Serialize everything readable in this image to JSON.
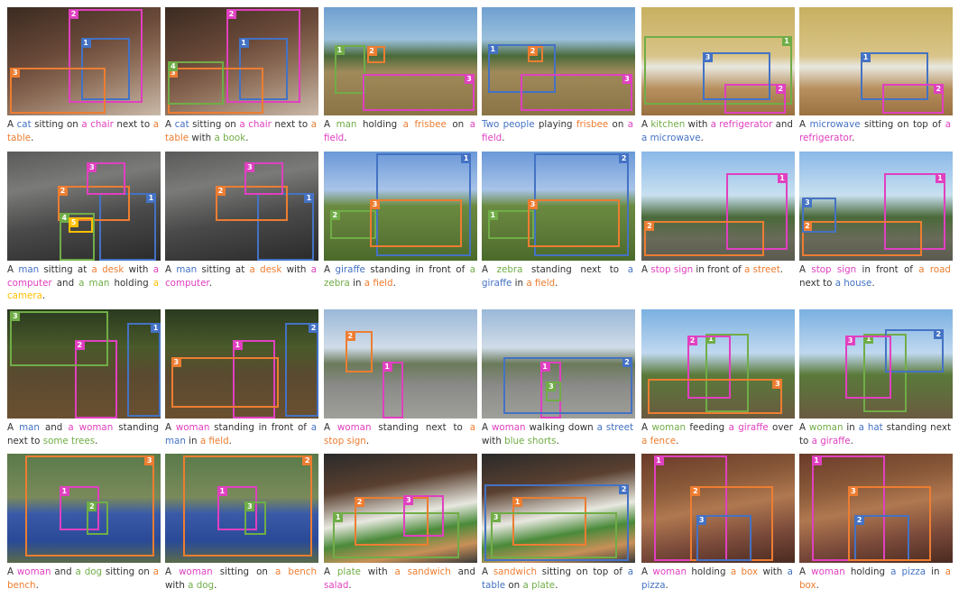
{
  "colors": {
    "blue": "#4472c4",
    "pink": "#e040c0",
    "orange": "#ed7d31",
    "green": "#70ad47",
    "yellow": "#ffc000",
    "text": "#333333"
  },
  "panels": [
    {
      "caption": [
        [
          "A ",
          "text"
        ],
        [
          "cat",
          "blue"
        ],
        [
          " sitting on ",
          "text"
        ],
        [
          "a chair",
          "pink"
        ],
        [
          " next to ",
          "text"
        ],
        [
          "a table",
          "orange"
        ],
        [
          ".",
          "text"
        ]
      ],
      "tags": [
        [
          "1",
          "blue"
        ],
        [
          "2",
          "pink"
        ],
        [
          "3",
          "orange"
        ]
      ],
      "scene": "cat-room"
    },
    {
      "caption": [
        [
          "A ",
          "text"
        ],
        [
          "cat",
          "blue"
        ],
        [
          " sitting on ",
          "text"
        ],
        [
          "a chair",
          "pink"
        ],
        [
          " next to ",
          "text"
        ],
        [
          "a table",
          "orange"
        ],
        [
          " with ",
          "text"
        ],
        [
          "a book",
          "green"
        ],
        [
          ".",
          "text"
        ]
      ],
      "tags": [
        [
          "1",
          "blue"
        ],
        [
          "2",
          "pink"
        ],
        [
          "3",
          "orange"
        ],
        [
          "4",
          "green"
        ]
      ],
      "scene": "cat-room"
    },
    {
      "caption": [
        [
          "A ",
          "text"
        ],
        [
          "man",
          "green"
        ],
        [
          " holding ",
          "text"
        ],
        [
          "a frisbee",
          "orange"
        ],
        [
          " on ",
          "text"
        ],
        [
          "a field",
          "pink"
        ],
        [
          ".",
          "text"
        ]
      ],
      "tags": [
        [
          "1",
          "green"
        ],
        [
          "2",
          "orange"
        ],
        [
          "3",
          "pink"
        ]
      ],
      "scene": "field"
    },
    {
      "caption": [
        [
          "Two people",
          "blue"
        ],
        [
          " playing ",
          "text"
        ],
        [
          "frisbee",
          "orange"
        ],
        [
          " on ",
          "text"
        ],
        [
          "a field",
          "pink"
        ],
        [
          ".",
          "text"
        ]
      ],
      "tags": [
        [
          "1",
          "blue"
        ],
        [
          "2",
          "orange"
        ],
        [
          "3",
          "pink"
        ]
      ],
      "scene": "field"
    },
    {
      "caption": [
        [
          "A ",
          "text"
        ],
        [
          "kitchen",
          "green"
        ],
        [
          " with ",
          "text"
        ],
        [
          "a refrigerator",
          "pink"
        ],
        [
          " and ",
          "text"
        ],
        [
          "a microwave",
          "blue"
        ],
        [
          ".",
          "text"
        ]
      ],
      "tags": [
        [
          "1",
          "green"
        ],
        [
          "2",
          "pink"
        ],
        [
          "3",
          "blue"
        ]
      ],
      "scene": "kitchen"
    },
    {
      "caption": [
        [
          "A ",
          "text"
        ],
        [
          "microwave",
          "blue"
        ],
        [
          " sitting on top of ",
          "text"
        ],
        [
          "a refrigerator",
          "pink"
        ],
        [
          ".",
          "text"
        ]
      ],
      "tags": [
        [
          "1",
          "blue"
        ],
        [
          "2",
          "pink"
        ]
      ],
      "scene": "kitchen"
    },
    {
      "caption": [
        [
          "A ",
          "text"
        ],
        [
          "man",
          "blue"
        ],
        [
          " sitting at ",
          "text"
        ],
        [
          "a desk",
          "orange"
        ],
        [
          " with ",
          "text"
        ],
        [
          "a computer",
          "pink"
        ],
        [
          " and ",
          "text"
        ],
        [
          "a man",
          "green"
        ],
        [
          " holding ",
          "text"
        ],
        [
          "a camera",
          "yellow"
        ],
        [
          ".",
          "text"
        ]
      ],
      "tags": [
        [
          "1",
          "blue"
        ],
        [
          "2",
          "orange"
        ],
        [
          "3",
          "pink"
        ],
        [
          "4",
          "green"
        ],
        [
          "5",
          "yellow"
        ]
      ],
      "scene": "office"
    },
    {
      "caption": [
        [
          "A ",
          "text"
        ],
        [
          "man",
          "blue"
        ],
        [
          " sitting at ",
          "text"
        ],
        [
          "a desk",
          "orange"
        ],
        [
          " with ",
          "text"
        ],
        [
          "a computer",
          "pink"
        ],
        [
          ".",
          "text"
        ]
      ],
      "tags": [
        [
          "1",
          "blue"
        ],
        [
          "2",
          "orange"
        ],
        [
          "3",
          "pink"
        ]
      ],
      "scene": "office"
    },
    {
      "caption": [
        [
          "A ",
          "text"
        ],
        [
          "giraffe",
          "blue"
        ],
        [
          " standing in front of ",
          "text"
        ],
        [
          "a zebra",
          "green"
        ],
        [
          " in ",
          "text"
        ],
        [
          "a field",
          "orange"
        ],
        [
          ".",
          "text"
        ]
      ],
      "tags": [
        [
          "1",
          "blue"
        ],
        [
          "2",
          "green"
        ],
        [
          "3",
          "orange"
        ]
      ],
      "scene": "savanna"
    },
    {
      "caption": [
        [
          "A ",
          "text"
        ],
        [
          "zebra",
          "green"
        ],
        [
          " standing next to ",
          "text"
        ],
        [
          "a giraffe",
          "blue"
        ],
        [
          " in ",
          "text"
        ],
        [
          "a field",
          "orange"
        ],
        [
          ".",
          "text"
        ]
      ],
      "tags": [
        [
          "1",
          "green"
        ],
        [
          "2",
          "blue"
        ],
        [
          "3",
          "orange"
        ]
      ],
      "scene": "savanna"
    },
    {
      "caption": [
        [
          "A ",
          "text"
        ],
        [
          "stop sign",
          "pink"
        ],
        [
          " in front of ",
          "text"
        ],
        [
          "a street",
          "orange"
        ],
        [
          ".",
          "text"
        ]
      ],
      "tags": [
        [
          "1",
          "pink"
        ],
        [
          "2",
          "orange"
        ]
      ],
      "scene": "stop"
    },
    {
      "caption": [
        [
          "A ",
          "text"
        ],
        [
          "stop sign",
          "pink"
        ],
        [
          " in front of ",
          "text"
        ],
        [
          "a road",
          "orange"
        ],
        [
          " next to ",
          "text"
        ],
        [
          "a house",
          "blue"
        ],
        [
          ".",
          "text"
        ]
      ],
      "tags": [
        [
          "1",
          "pink"
        ],
        [
          "2",
          "orange"
        ],
        [
          "3",
          "blue"
        ]
      ],
      "scene": "stop"
    },
    {
      "caption": [
        [
          "A ",
          "text"
        ],
        [
          "man",
          "blue"
        ],
        [
          " and ",
          "text"
        ],
        [
          "a woman",
          "pink"
        ],
        [
          " standing next to ",
          "text"
        ],
        [
          "some trees",
          "green"
        ],
        [
          ".",
          "text"
        ]
      ],
      "tags": [
        [
          "1",
          "blue"
        ],
        [
          "2",
          "pink"
        ],
        [
          "3",
          "green"
        ]
      ],
      "scene": "night"
    },
    {
      "caption": [
        [
          "A ",
          "text"
        ],
        [
          "woman",
          "pink"
        ],
        [
          " standing in front of ",
          "text"
        ],
        [
          "a man",
          "blue"
        ],
        [
          " in ",
          "text"
        ],
        [
          "a field",
          "orange"
        ],
        [
          ".",
          "text"
        ]
      ],
      "tags": [
        [
          "1",
          "pink"
        ],
        [
          "2",
          "blue"
        ],
        [
          "3",
          "orange"
        ]
      ],
      "scene": "night"
    },
    {
      "caption": [
        [
          "A ",
          "text"
        ],
        [
          "woman",
          "pink"
        ],
        [
          " standing next to ",
          "text"
        ],
        [
          "a stop sign",
          "orange"
        ],
        [
          ".",
          "text"
        ]
      ],
      "tags": [
        [
          "1",
          "pink"
        ],
        [
          "2",
          "orange"
        ]
      ],
      "scene": "road"
    },
    {
      "caption": [
        [
          "A ",
          "text"
        ],
        [
          "woman",
          "pink"
        ],
        [
          " walking down ",
          "text"
        ],
        [
          "a street",
          "blue"
        ],
        [
          " with ",
          "text"
        ],
        [
          "blue shorts",
          "green"
        ],
        [
          ".",
          "text"
        ]
      ],
      "tags": [
        [
          "1",
          "pink"
        ],
        [
          "2",
          "blue"
        ],
        [
          "3",
          "green"
        ]
      ],
      "scene": "road"
    },
    {
      "caption": [
        [
          "A ",
          "text"
        ],
        [
          "woman",
          "green"
        ],
        [
          " feeding ",
          "text"
        ],
        [
          "a giraffe",
          "pink"
        ],
        [
          " over ",
          "text"
        ],
        [
          "a fence",
          "orange"
        ],
        [
          ".",
          "text"
        ]
      ],
      "tags": [
        [
          "1",
          "green"
        ],
        [
          "2",
          "pink"
        ],
        [
          "3",
          "orange"
        ]
      ],
      "scene": "zoo"
    },
    {
      "caption": [
        [
          "A ",
          "text"
        ],
        [
          "woman",
          "green"
        ],
        [
          " in ",
          "text"
        ],
        [
          "a hat",
          "blue"
        ],
        [
          " standing next to ",
          "text"
        ],
        [
          "a giraffe",
          "pink"
        ],
        [
          ".",
          "text"
        ]
      ],
      "tags": [
        [
          "1",
          "green"
        ],
        [
          "2",
          "blue"
        ],
        [
          "3",
          "pink"
        ]
      ],
      "scene": "zoo"
    },
    {
      "caption": [
        [
          "A ",
          "text"
        ],
        [
          "woman",
          "pink"
        ],
        [
          " and ",
          "text"
        ],
        [
          "a dog",
          "green"
        ],
        [
          " sitting on ",
          "text"
        ],
        [
          "a bench",
          "orange"
        ],
        [
          ".",
          "text"
        ]
      ],
      "tags": [
        [
          "1",
          "pink"
        ],
        [
          "2",
          "green"
        ],
        [
          "3",
          "orange"
        ]
      ],
      "scene": "chair"
    },
    {
      "caption": [
        [
          "A ",
          "text"
        ],
        [
          "woman",
          "pink"
        ],
        [
          " sitting on ",
          "text"
        ],
        [
          "a bench",
          "orange"
        ],
        [
          " with ",
          "text"
        ],
        [
          "a dog",
          "green"
        ],
        [
          ".",
          "text"
        ]
      ],
      "tags": [
        [
          "1",
          "pink"
        ],
        [
          "2",
          "orange"
        ],
        [
          "3",
          "green"
        ]
      ],
      "scene": "chair"
    },
    {
      "caption": [
        [
          "A ",
          "text"
        ],
        [
          "plate",
          "green"
        ],
        [
          " with ",
          "text"
        ],
        [
          "a sandwich",
          "orange"
        ],
        [
          " and ",
          "text"
        ],
        [
          "salad",
          "pink"
        ],
        [
          ".",
          "text"
        ]
      ],
      "tags": [
        [
          "1",
          "green"
        ],
        [
          "2",
          "orange"
        ],
        [
          "3",
          "pink"
        ]
      ],
      "scene": "food"
    },
    {
      "caption": [
        [
          "A ",
          "text"
        ],
        [
          "sandwich",
          "orange"
        ],
        [
          " sitting on top of ",
          "text"
        ],
        [
          "a table",
          "blue"
        ],
        [
          " on ",
          "text"
        ],
        [
          "a plate",
          "green"
        ],
        [
          ".",
          "text"
        ]
      ],
      "tags": [
        [
          "1",
          "orange"
        ],
        [
          "2",
          "blue"
        ],
        [
          "3",
          "green"
        ]
      ],
      "scene": "food"
    },
    {
      "caption": [
        [
          "A ",
          "text"
        ],
        [
          "woman",
          "pink"
        ],
        [
          " holding ",
          "text"
        ],
        [
          "a box",
          "orange"
        ],
        [
          " with ",
          "text"
        ],
        [
          "a pizza",
          "blue"
        ],
        [
          ".",
          "text"
        ]
      ],
      "tags": [
        [
          "1",
          "pink"
        ],
        [
          "2",
          "orange"
        ],
        [
          "3",
          "blue"
        ]
      ],
      "scene": "pizza"
    },
    {
      "caption": [
        [
          "A ",
          "text"
        ],
        [
          "woman",
          "pink"
        ],
        [
          " holding ",
          "text"
        ],
        [
          "a pizza",
          "blue"
        ],
        [
          " in ",
          "text"
        ],
        [
          "a box",
          "orange"
        ],
        [
          ".",
          "text"
        ]
      ],
      "tags": [
        [
          "1",
          "pink"
        ],
        [
          "2",
          "blue"
        ],
        [
          "3",
          "orange"
        ]
      ],
      "scene": "pizza"
    }
  ]
}
